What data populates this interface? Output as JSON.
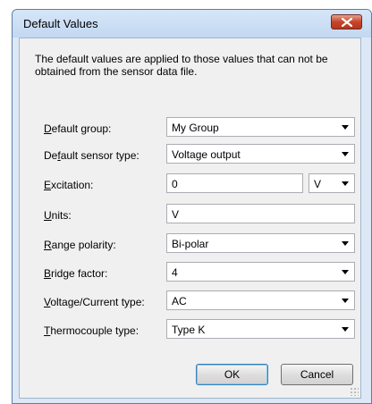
{
  "window": {
    "title": "Default Values"
  },
  "description": "The default values are applied to those values that can not be obtained from the sensor data file.",
  "fields": {
    "default_group": {
      "label_mn": "D",
      "label_rest": "efault group:",
      "value": "My Group"
    },
    "default_sensor_type": {
      "label_pre": "De",
      "label_mn": "f",
      "label_rest": "ault sensor type:",
      "value": "Voltage output"
    },
    "excitation": {
      "label_mn": "E",
      "label_rest": "xcitation:",
      "value": "0",
      "unit_value": "V"
    },
    "units": {
      "label_mn": "U",
      "label_rest": "nits:",
      "value": "V"
    },
    "range_polarity": {
      "label_mn": "R",
      "label_rest": "ange polarity:",
      "value": "Bi-polar"
    },
    "bridge_factor": {
      "label_mn": "B",
      "label_rest": "ridge factor:",
      "value": "4"
    },
    "voltage_current_type": {
      "label_mn": "V",
      "label_rest": "oltage/Current type:",
      "value": "AC"
    },
    "thermocouple_type": {
      "label_mn": "T",
      "label_rest": "hermocouple type:",
      "value": "Type K"
    }
  },
  "buttons": {
    "ok": "OK",
    "cancel": "Cancel"
  },
  "icons": {
    "close": "close-icon",
    "dropdown": "chevron-down-icon"
  },
  "colors": {
    "titlebar": "#c9dcf2",
    "close_button": "#c5462b",
    "client_background": "#f0f0f0"
  }
}
